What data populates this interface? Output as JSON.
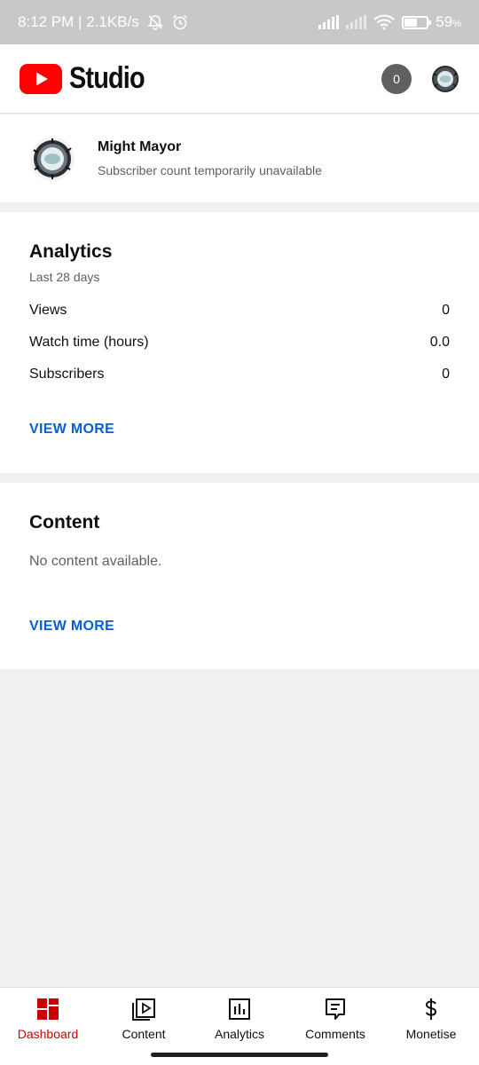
{
  "status_bar": {
    "time_speed": "8:12 PM | 2.1KB/s",
    "battery_percent": "59",
    "battery_unit": "%",
    "battery_level": 0.59,
    "icons": [
      "mute-bell-icon",
      "alarm-icon",
      "signal-icon",
      "signal-icon",
      "wifi-icon",
      "battery-icon"
    ]
  },
  "app_bar": {
    "logo_text": "Studio",
    "notification_count": "0",
    "brand_color": "#ff0000"
  },
  "channel": {
    "name": "Might Mayor",
    "subtitle": "Subscriber count temporarily unavailable"
  },
  "analytics": {
    "title": "Analytics",
    "caption": "Last 28 days",
    "metrics": [
      {
        "label": "Views",
        "value": "0"
      },
      {
        "label": "Watch time (hours)",
        "value": "0.0"
      },
      {
        "label": "Subscribers",
        "value": "0"
      }
    ],
    "view_more": "VIEW MORE"
  },
  "content": {
    "title": "Content",
    "empty_text": "No content available.",
    "view_more": "VIEW MORE"
  },
  "bottom_nav": {
    "items": [
      {
        "label": "Dashboard",
        "icon": "dashboard-icon",
        "active": true
      },
      {
        "label": "Content",
        "icon": "content-icon",
        "active": false
      },
      {
        "label": "Analytics",
        "icon": "analytics-icon",
        "active": false
      },
      {
        "label": "Comments",
        "icon": "comments-icon",
        "active": false
      },
      {
        "label": "Monetise",
        "icon": "monetise-icon",
        "active": false
      }
    ]
  },
  "colors": {
    "active": "#cc0000",
    "link": "#065fd4",
    "background": "#f0f0f0"
  }
}
